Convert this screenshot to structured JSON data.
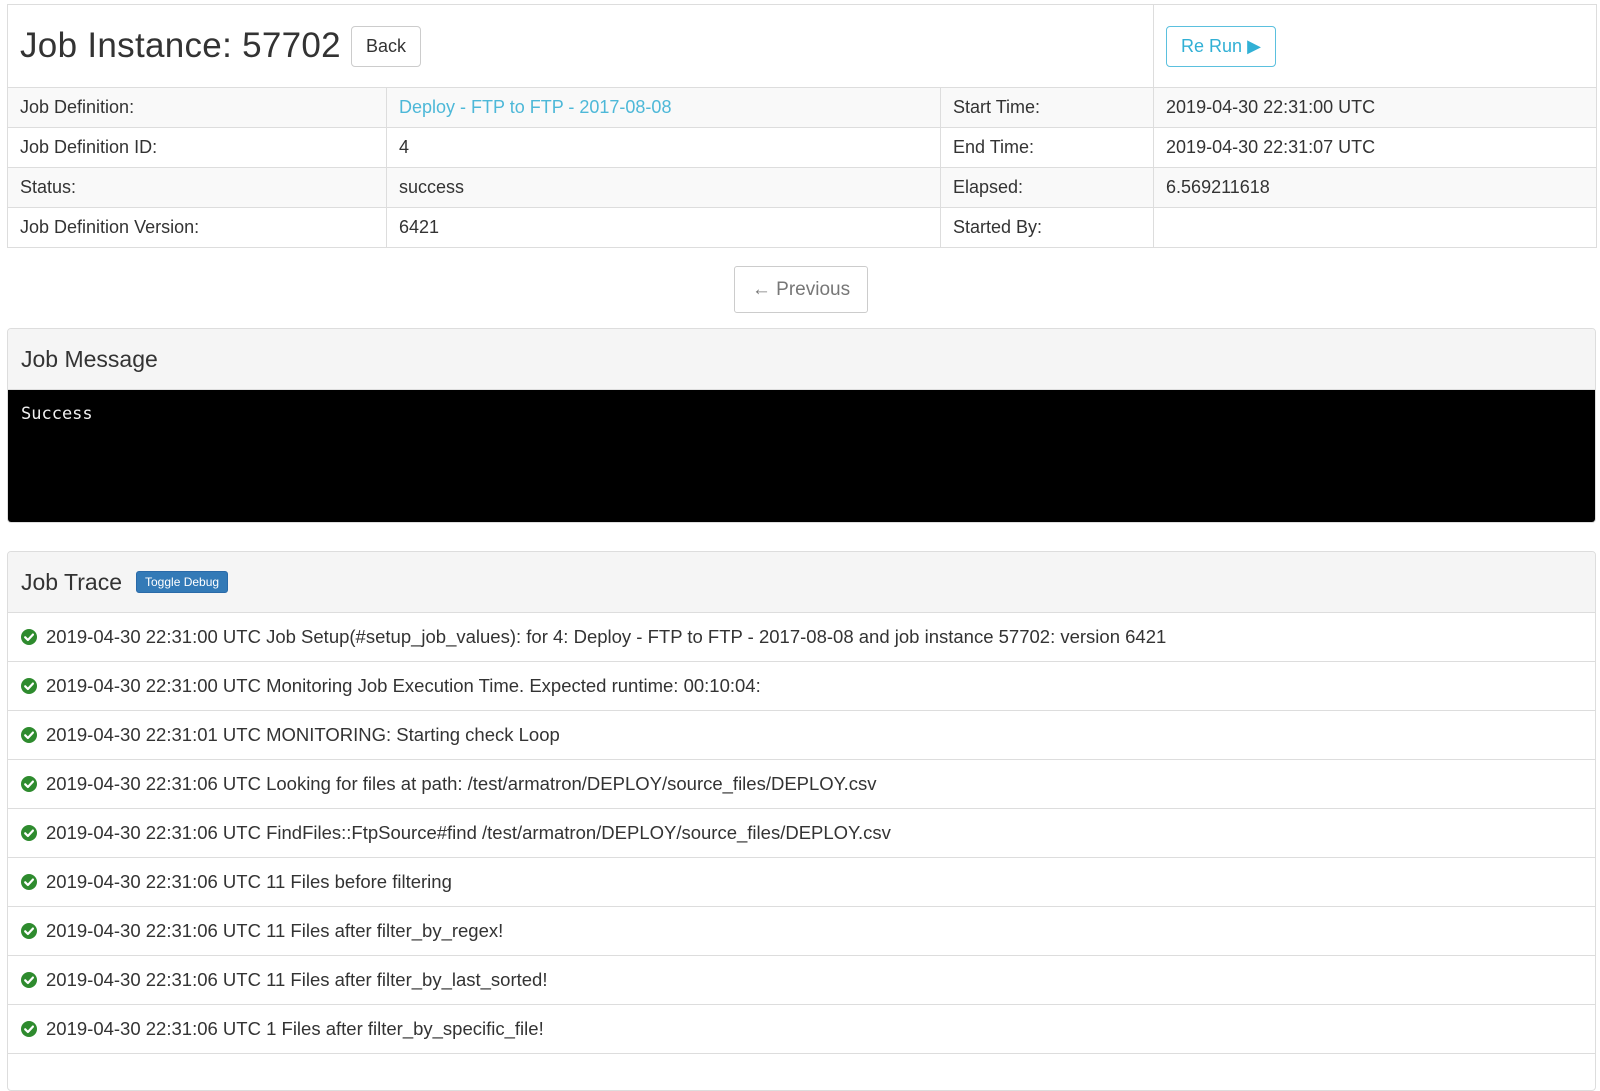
{
  "header": {
    "title": "Job Instance: 57702",
    "back_label": "Back",
    "rerun_label": "Re Run ▶"
  },
  "details": {
    "job_definition_label": "Job Definition:",
    "job_definition_value": "Deploy - FTP to FTP - 2017-08-08",
    "job_definition_id_label": "Job Definition ID:",
    "job_definition_id_value": "4",
    "status_label": "Status:",
    "status_value": "success",
    "job_definition_version_label": "Job Definition Version:",
    "job_definition_version_value": "6421",
    "start_time_label": "Start Time:",
    "start_time_value": "2019-04-30 22:31:00 UTC",
    "end_time_label": "End Time:",
    "end_time_value": "2019-04-30 22:31:07 UTC",
    "elapsed_label": "Elapsed:",
    "elapsed_value": "6.569211618",
    "started_by_label": "Started By:"
  },
  "nav": {
    "previous_label": "← Previous"
  },
  "job_message": {
    "title": "Job Message",
    "body": "Success"
  },
  "job_trace": {
    "title": "Job Trace",
    "toggle_label": "Toggle Debug",
    "status_icon": "check-circle-icon",
    "status_color": "#2e8b2e",
    "entries": [
      "2019-04-30 22:31:00 UTC Job Setup(#setup_job_values): for 4: Deploy - FTP to FTP - 2017-08-08 and job instance 57702: version 6421",
      "2019-04-30 22:31:00 UTC Monitoring Job Execution Time. Expected runtime: 00:10:04:",
      "2019-04-30 22:31:01 UTC MONITORING: Starting check Loop",
      "2019-04-30 22:31:06 UTC Looking for files at path: /test/armatron/DEPLOY/source_files/DEPLOY.csv",
      "2019-04-30 22:31:06 UTC FindFiles::FtpSource#find /test/armatron/DEPLOY/source_files/DEPLOY.csv",
      "2019-04-30 22:31:06 UTC 11 Files before filtering",
      "2019-04-30 22:31:06 UTC 11 Files after filter_by_regex!",
      "2019-04-30 22:31:06 UTC 11 Files after filter_by_last_sorted!",
      "2019-04-30 22:31:06 UTC 1 Files after filter_by_specific_file!"
    ]
  }
}
